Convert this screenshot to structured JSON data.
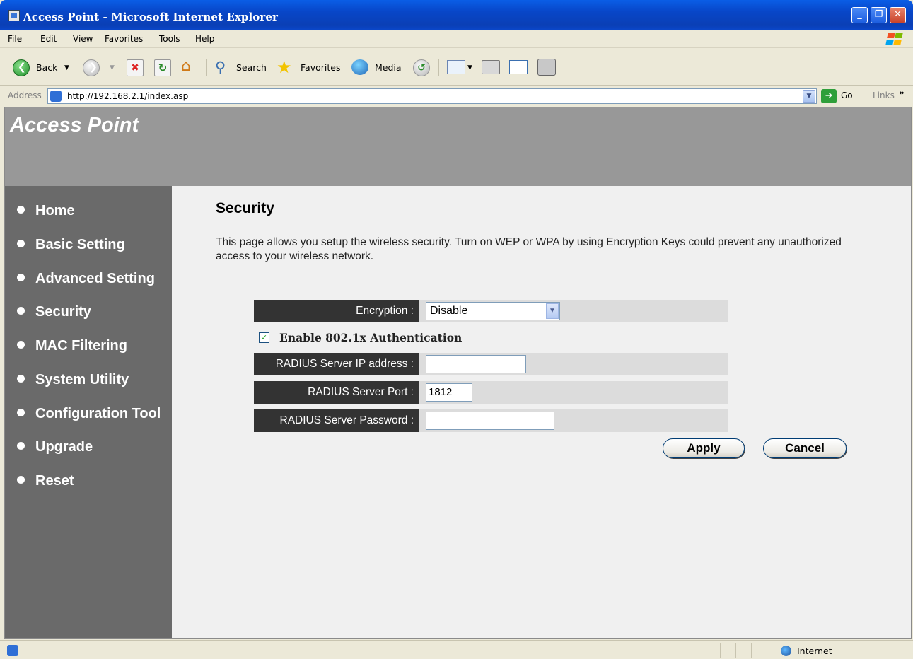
{
  "window": {
    "title": "Access Point - Microsoft Internet Explorer"
  },
  "menu": [
    "File",
    "Edit",
    "View",
    "Favorites",
    "Tools",
    "Help"
  ],
  "toolbar": {
    "back_label": "Back",
    "search_label": "Search",
    "favorites_label": "Favorites",
    "media_label": "Media"
  },
  "address": {
    "label": "Address",
    "url": "http://192.168.2.1/index.asp",
    "go_label": "Go",
    "links_label": "Links",
    "links_chevron": "»"
  },
  "page": {
    "brand": "Access Point",
    "nav": [
      "Home",
      "Basic Setting",
      "Advanced Setting",
      "Security",
      "MAC Filtering",
      "System Utility",
      "Configuration Tool",
      "Upgrade",
      "Reset"
    ],
    "title": "Security",
    "description": "This page allows you setup the wireless security. Turn on WEP or WPA by using Encryption Keys could prevent any unauthorized access to your wireless network.",
    "form": {
      "encryption_label": "Encryption :",
      "encryption_value": "Disable",
      "enable_8021x_label": "Enable 802.1x Authentication",
      "enable_8021x_checked": true,
      "radius_ip_label": "RADIUS Server IP address :",
      "radius_ip_value": "",
      "radius_port_label": "RADIUS Server Port :",
      "radius_port_value": "1812",
      "radius_password_label": "RADIUS Server Password :",
      "radius_password_value": "",
      "apply_label": "Apply",
      "cancel_label": "Cancel"
    }
  },
  "status": {
    "zone": "Internet"
  },
  "colors": {
    "banner": "#989898",
    "sidebar": "#6a6a6a",
    "label_bg": "#333333",
    "content_bg": "#f0f0f0"
  }
}
